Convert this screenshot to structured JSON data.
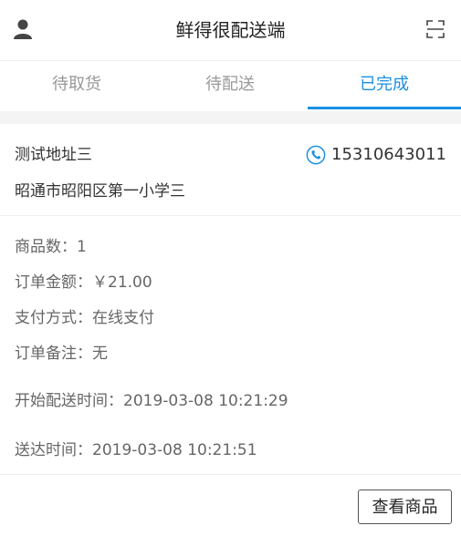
{
  "header": {
    "title": "鲜得很配送端",
    "left_icon": "user-icon",
    "right_icon": "scan-icon"
  },
  "tabs": [
    {
      "label": "待取货",
      "active": false
    },
    {
      "label": "待配送",
      "active": false
    },
    {
      "label": "已完成",
      "active": true
    }
  ],
  "order": {
    "contact_name": "测试地址三",
    "phone": "15310643011",
    "address": "昭通市昭阳区第一小学三",
    "item_count": "商品数：1",
    "amount": "订单金额：￥21.00",
    "payment": "支付方式：在线支付",
    "note": "订单备注：无",
    "start_time": "开始配送时间：2019-03-08 10:21:29",
    "delivered_time": "送达时间：2019-03-08 10:21:51",
    "view_button": "查看商品"
  },
  "colors": {
    "accent": "#1b90e3",
    "text": "#333333",
    "muted": "#999999"
  }
}
